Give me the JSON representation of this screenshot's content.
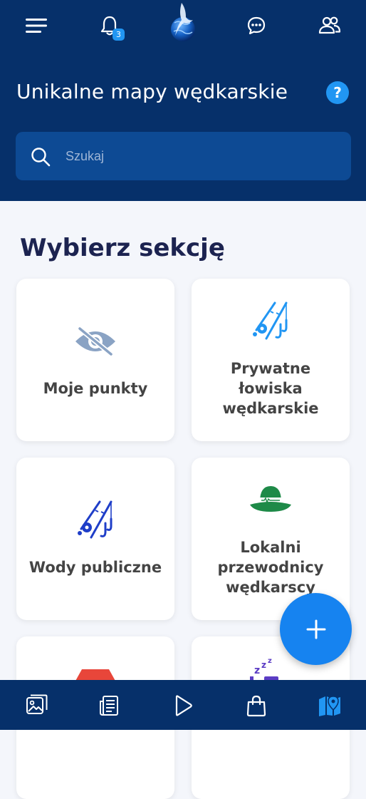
{
  "topbar": {
    "menu_icon": "hamburger-menu-icon",
    "notifications_icon": "bell-icon",
    "notifications_count": "3",
    "logo": "marlin-globe-logo",
    "chat_icon": "chat-bubble-icon",
    "friends_icon": "people-icon"
  },
  "header": {
    "title": "Unikalne mapy wędkarskie",
    "help_label": "?"
  },
  "search": {
    "placeholder": "Szukaj"
  },
  "section": {
    "title": "Wybierz sekcję"
  },
  "cards": [
    {
      "label": "Moje punkty",
      "icon": "eye-off-icon"
    },
    {
      "label": "Prywatne łowiska wędkarskie",
      "icon": "fishing-rods-icon"
    },
    {
      "label": "Wody publiczne",
      "icon": "fishing-rods-icon"
    },
    {
      "label": "Lokalni przewodnicy wędkarscy",
      "icon": "guide-hat-icon"
    },
    {
      "label": "",
      "icon": "red-shape-icon"
    },
    {
      "label": "",
      "icon": "sleep-icon"
    }
  ],
  "fab": {
    "icon": "plus-icon"
  },
  "bottom_nav": [
    {
      "name": "gallery",
      "icon": "gallery-icon"
    },
    {
      "name": "news",
      "icon": "news-icon"
    },
    {
      "name": "video",
      "icon": "play-icon"
    },
    {
      "name": "shop",
      "icon": "shopping-bag-icon"
    },
    {
      "name": "maps",
      "icon": "map-pin-icon",
      "active": true
    }
  ],
  "colors": {
    "header_bg": "#06306a",
    "search_bg": "#0d4a94",
    "accent": "#2196f3",
    "page_bg": "#f4f6fb",
    "section_title": "#1c2350",
    "card_label": "#444444",
    "fab": "#1683f0",
    "guide_hat": "#1e8a48"
  }
}
